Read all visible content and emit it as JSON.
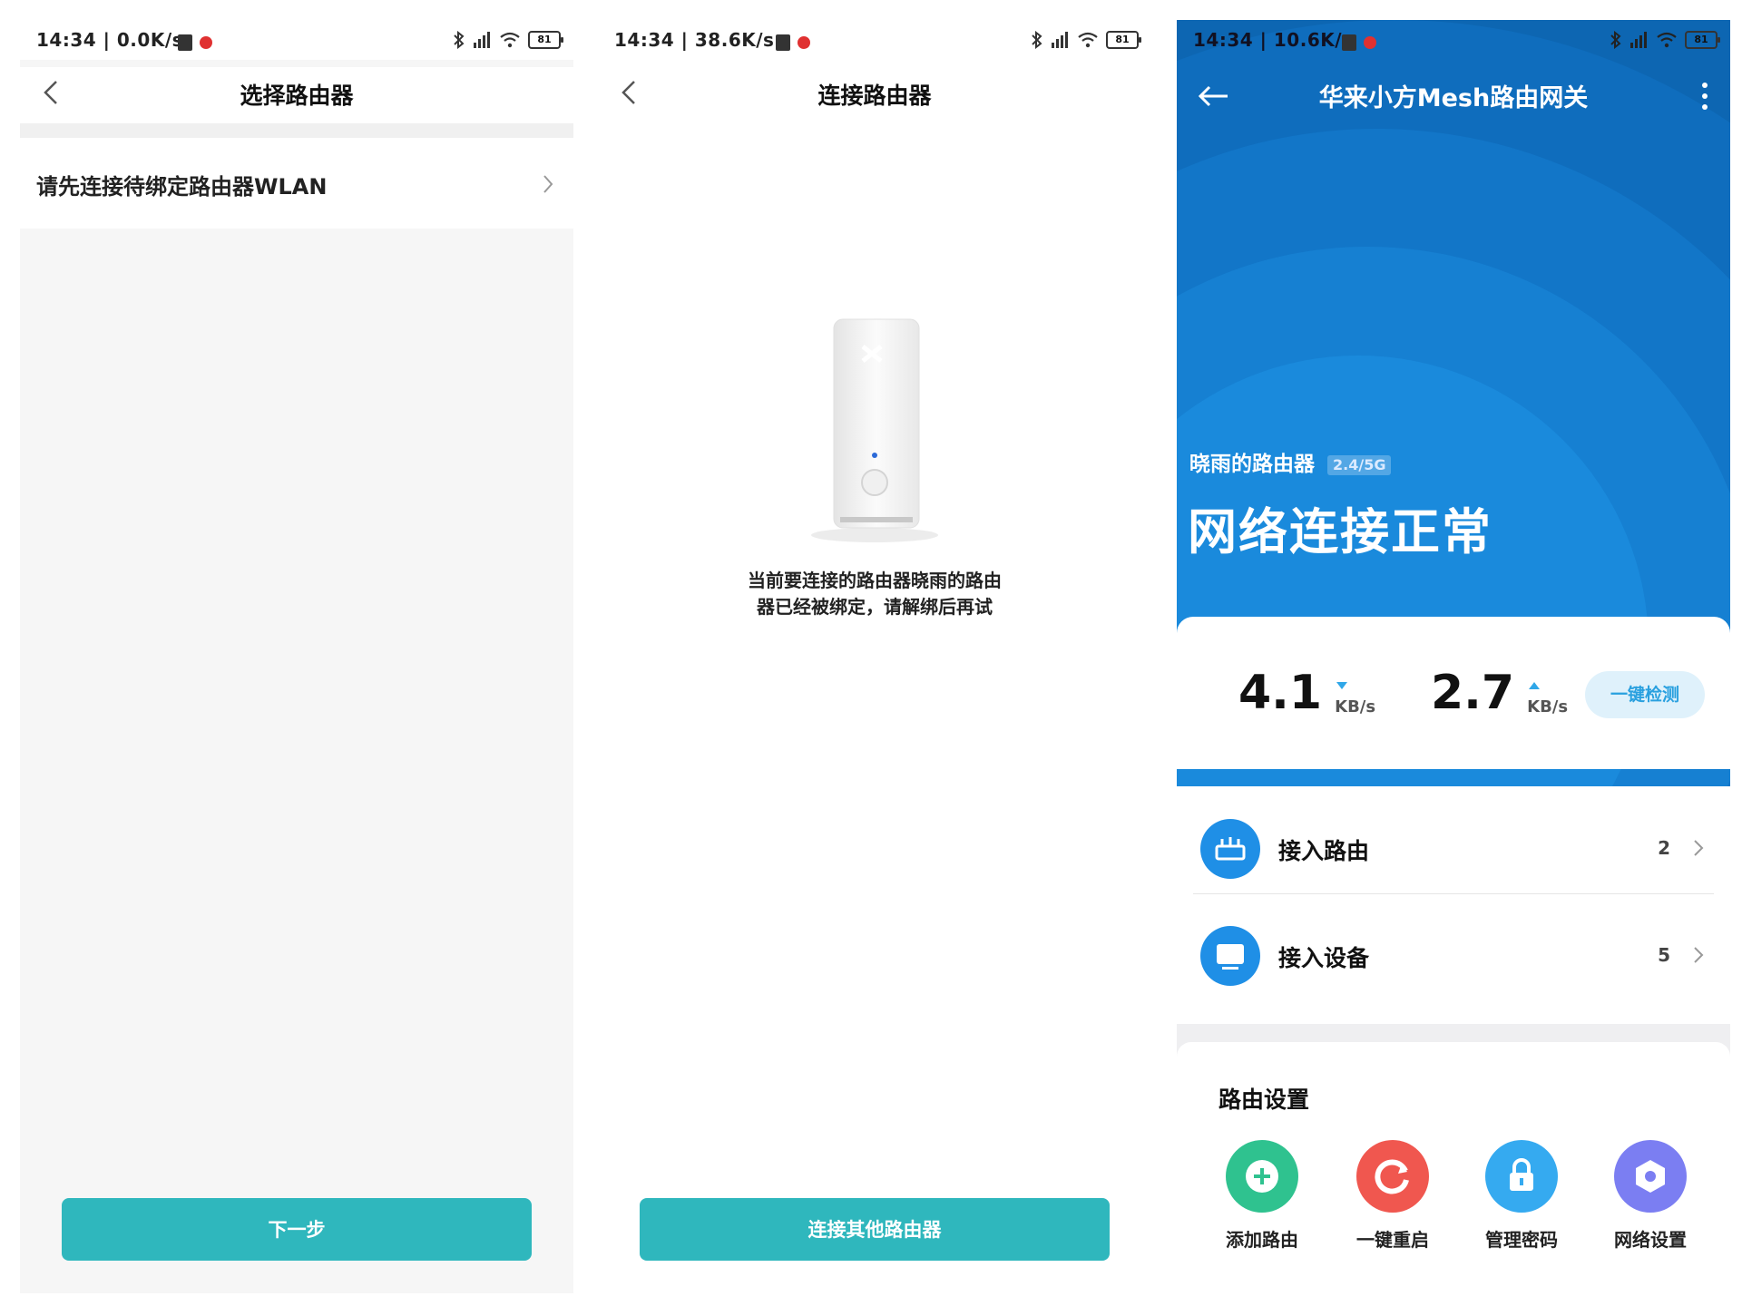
{
  "screen1": {
    "status": {
      "time": "14:34 | 0.0K/s",
      "battery": "81"
    },
    "title": "选择路由器",
    "row_label": "请先连接待绑定路由器WLAN",
    "next_button": "下一步"
  },
  "screen2": {
    "status": {
      "time": "14:34 | 38.6K/s",
      "battery": "81"
    },
    "title": "连接路由器",
    "message_line1": "当前要连接的路由器晓雨的路由",
    "message_line2": "器已经被绑定，请解绑后再试",
    "connect_other_button": "连接其他路由器"
  },
  "screen3": {
    "status": {
      "time": "14:34 | 10.6K/s",
      "battery": "81"
    },
    "title": "华来小方Mesh路由网关",
    "router_name": "晓雨的路由器",
    "band_badge": "2.4/5G",
    "connection_status": "网络连接正常",
    "download_speed": "4.1",
    "download_unit": "KB/s",
    "upload_speed": "2.7",
    "upload_unit": "KB/s",
    "detect_button": "一键检测",
    "list": [
      {
        "label": "接入路由",
        "count": "2"
      },
      {
        "label": "接入设备",
        "count": "5"
      }
    ],
    "settings_title": "路由设置",
    "actions": [
      {
        "label": "添加路由",
        "color": "#2fc28f"
      },
      {
        "label": "一键重启",
        "color": "#f0574f"
      },
      {
        "label": "管理密码",
        "color": "#35aaf0"
      },
      {
        "label": "网络设置",
        "color": "#7b7ef2"
      }
    ],
    "accent_blue": "#0a5ea7"
  }
}
